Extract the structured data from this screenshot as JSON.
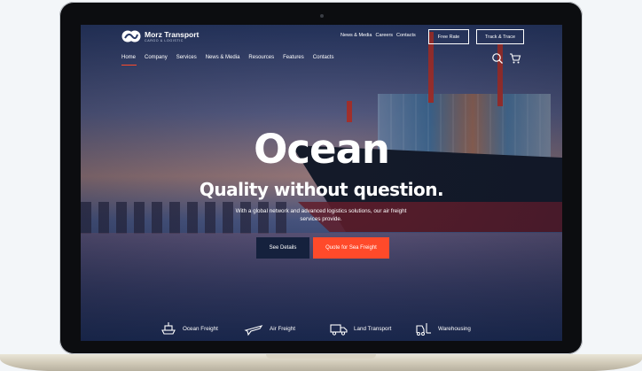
{
  "brand": {
    "name": "Morz Transport",
    "tagline": "CARGO & LOGISTIC"
  },
  "utility_nav": [
    "News & Media",
    "Careers",
    "Contacts"
  ],
  "header_buttons": {
    "free_rate": "Free Rate",
    "track_trace": "Track & Trace"
  },
  "main_nav": {
    "items": [
      "Home",
      "Company",
      "Services",
      "News & Media",
      "Resources",
      "Features",
      "Contacts"
    ],
    "active": "Home"
  },
  "hero": {
    "title": "Ocean",
    "subtitle": "Quality without question.",
    "description": "With a global network and advanced logistics solutions, our air freight services provide.",
    "primary_button": "See Details",
    "secondary_button": "Quote for Sea Freight"
  },
  "services": [
    {
      "label": "Ocean Freight",
      "icon": "ship-icon"
    },
    {
      "label": "Air Freight",
      "icon": "plane-icon"
    },
    {
      "label": "Land Transport",
      "icon": "truck-icon"
    },
    {
      "label": "Warehousing",
      "icon": "forklift-icon"
    }
  ],
  "colors": {
    "accent": "#ff4a2a",
    "navy_button": "#15213d",
    "hero_overlay": "#1e2f57"
  }
}
